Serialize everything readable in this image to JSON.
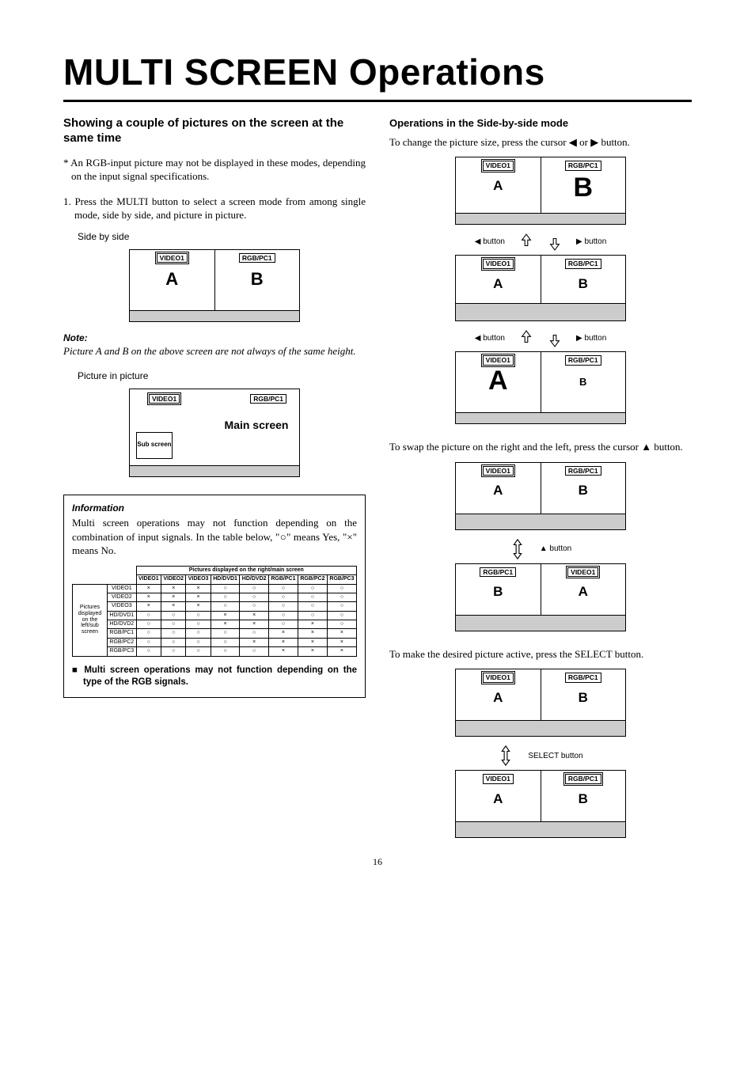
{
  "page": {
    "title_bold": "MULTI SCREEN",
    "title_rest": " Operations",
    "page_number": "16"
  },
  "left": {
    "section_heading": "Showing a couple of pictures on the screen at the same time",
    "footnote": "* An RGB-input picture may not be displayed in these modes, depending on the input signal specifications.",
    "step1": "1. Press the MULTI button to select a screen mode from among single mode, side by side, and picture in picture.",
    "side_by_side_label": "Side by side",
    "note_head": "Note:",
    "note_body": "Picture A and B on the above screen are not always of the same height.",
    "pip_label": "Picture in picture",
    "pip": {
      "chip_left": "VIDEO1",
      "chip_right": "RGB/PC1",
      "sub": "Sub\nscreen",
      "main": "Main screen"
    },
    "sbs": {
      "chip_left": "VIDEO1",
      "chip_right": "RGB/PC1",
      "A": "A",
      "B": "B"
    },
    "info": {
      "head": "Information",
      "body": "Multi screen operations may not function depending on the combination of input signals. In the table below, \"○\" means Yes, \"×\" means No.",
      "table_caption": "Pictures displayed on the right/main screen",
      "row_header": "Pictures displayed on the left/sub screen",
      "cols": [
        "VIDEO1",
        "VIDEO2",
        "VIDEO3",
        "HD/DVD1",
        "HD/DVD2",
        "RGB/PC1",
        "RGB/PC2",
        "RGB/PC3"
      ],
      "rows": [
        "VIDEO1",
        "VIDEO2",
        "VIDEO3",
        "HD/DVD1",
        "HD/DVD2",
        "RGB/PC1",
        "RGB/PC2",
        "RGB/PC3"
      ],
      "cells": [
        [
          "×",
          "×",
          "×",
          "○",
          "○",
          "○",
          "○",
          "○"
        ],
        [
          "×",
          "×",
          "×",
          "○",
          "○",
          "○",
          "○",
          "○"
        ],
        [
          "×",
          "×",
          "×",
          "○",
          "○",
          "○",
          "○",
          "○"
        ],
        [
          "○",
          "○",
          "○",
          "×",
          "×",
          "○",
          "○",
          "○"
        ],
        [
          "○",
          "○",
          "○",
          "×",
          "×",
          "○",
          "×",
          "○"
        ],
        [
          "○",
          "○",
          "○",
          "○",
          "○",
          "×",
          "×",
          "×"
        ],
        [
          "○",
          "○",
          "○",
          "○",
          "×",
          "×",
          "×",
          "×"
        ],
        [
          "○",
          "○",
          "○",
          "○",
          "○",
          "×",
          "×",
          "×"
        ]
      ],
      "footer": "■  Multi screen operations may not function depending on the type of the RGB signals."
    }
  },
  "right": {
    "heading": "Operations in the Side-by-side mode",
    "intro": "To change the picture size, press the cursor ◀ or ▶ button.",
    "button_left": "◀ button",
    "button_right": "▶ button",
    "button_up": "▲ button",
    "select_button": "SELECT button",
    "swap_text": "To swap the picture on the right and the left, press the cursor ▲ button.",
    "active_text": "To  make the desired picture active, press the SELECT button.",
    "frame_a_b": {
      "chip_l": "VIDEO1",
      "chip_r": "RGB/PC1",
      "A": "A",
      "B": "B"
    },
    "frame_b_a": {
      "chip_l": "RGB/PC1",
      "chip_r": "VIDEO1",
      "A": "A",
      "B": "B"
    }
  }
}
